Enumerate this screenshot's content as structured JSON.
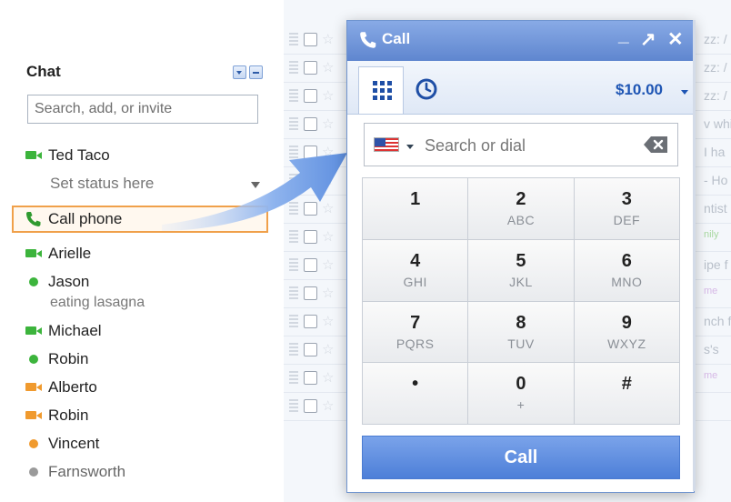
{
  "colors": {
    "accent": "#5f86cf",
    "highlight_border": "#f0a04a",
    "video_green": "#3cb43c",
    "online_green": "#3cb43c",
    "idle_orange": "#f09a2e",
    "offline_grey": "#9a9a9a"
  },
  "background_list": {
    "snippets": [
      "zz: /",
      "zz: /",
      "zz: /",
      "v whi",
      "I ha",
      "- Ho",
      "ntist",
      "nily",
      "ipe f",
      "me",
      "nch f",
      "s's",
      "me",
      ""
    ]
  },
  "chat": {
    "title": "Chat",
    "search_placeholder": "Search, add, or invite",
    "me": {
      "name": "Ted Taco",
      "status": "Set status here",
      "icon": "video-camera-icon"
    },
    "call_phone_label": "Call phone",
    "contacts": [
      {
        "name": "Arielle",
        "icon": "video-camera-icon",
        "presence": "video"
      },
      {
        "name": "Jason",
        "icon": "online-dot-icon",
        "presence": "online",
        "status_message": "eating lasagna"
      },
      {
        "name": "Michael",
        "icon": "video-camera-icon",
        "presence": "video"
      },
      {
        "name": "Robin",
        "icon": "online-dot-icon",
        "presence": "online"
      },
      {
        "name": "Alberto",
        "icon": "video-camera-idle-icon",
        "presence": "idle-video"
      },
      {
        "name": "Robin",
        "icon": "video-camera-idle-icon",
        "presence": "idle-video"
      },
      {
        "name": "Vincent",
        "icon": "idle-dot-icon",
        "presence": "idle"
      },
      {
        "name": "Farnsworth",
        "icon": "offline-dot-icon",
        "presence": "offline"
      }
    ]
  },
  "call_dialog": {
    "title": "Call",
    "minimize": "_",
    "popout": "↗",
    "close": "✕",
    "tabs": [
      "dialpad-icon",
      "history-clock-icon"
    ],
    "balance": "$10.00",
    "dial_placeholder": "Search or dial",
    "keypad": [
      {
        "digit": "1",
        "letters": ""
      },
      {
        "digit": "2",
        "letters": "ABC"
      },
      {
        "digit": "3",
        "letters": "DEF"
      },
      {
        "digit": "4",
        "letters": "GHI"
      },
      {
        "digit": "5",
        "letters": "JKL"
      },
      {
        "digit": "6",
        "letters": "MNO"
      },
      {
        "digit": "7",
        "letters": "PQRS"
      },
      {
        "digit": "8",
        "letters": "TUV"
      },
      {
        "digit": "9",
        "letters": "WXYZ"
      },
      {
        "digit": "•",
        "letters": ""
      },
      {
        "digit": "0",
        "letters": "+"
      },
      {
        "digit": "#",
        "letters": ""
      }
    ],
    "call_button": "Call"
  }
}
